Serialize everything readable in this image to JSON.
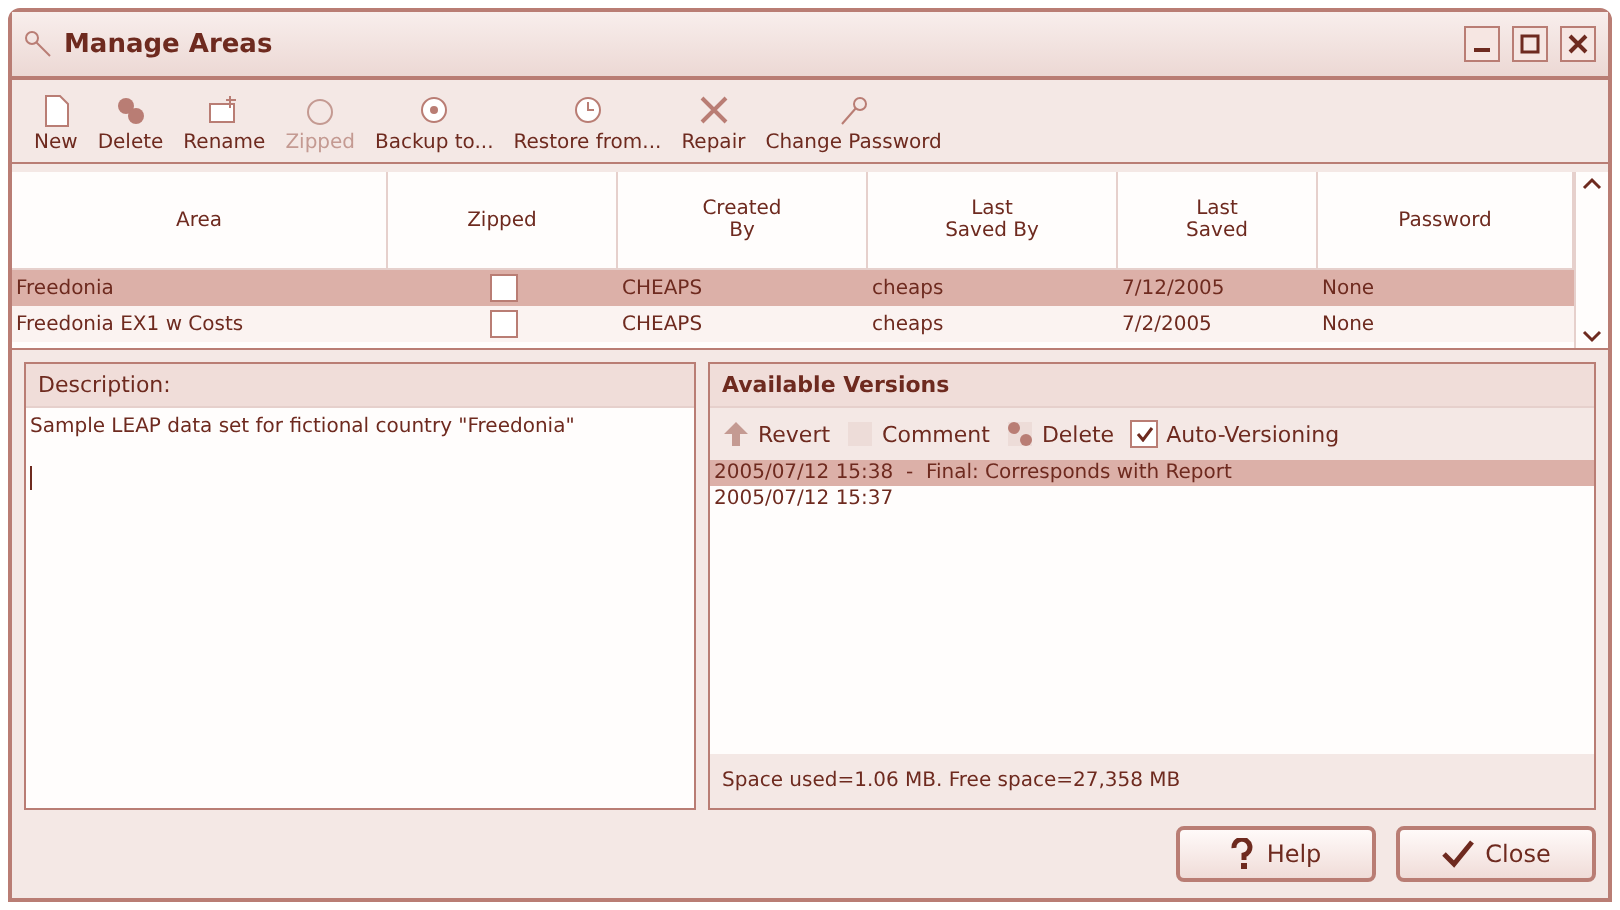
{
  "window": {
    "title": "Manage Areas"
  },
  "toolbar": [
    {
      "label": "New",
      "disabled": false
    },
    {
      "label": "Delete",
      "disabled": false
    },
    {
      "label": "Rename",
      "disabled": false
    },
    {
      "label": "Zipped",
      "disabled": true
    },
    {
      "label": "Backup to...",
      "disabled": false
    },
    {
      "label": "Restore from...",
      "disabled": false
    },
    {
      "label": "Repair",
      "disabled": false
    },
    {
      "label": "Change Password",
      "disabled": false
    }
  ],
  "table": {
    "columns": [
      "Area",
      "Zipped",
      "Created\nBy",
      "Last\nSaved By",
      "Last\nSaved",
      "Password"
    ],
    "rows": [
      {
        "area": "Freedonia",
        "zipped": false,
        "created_by": "CHEAPS",
        "last_saved_by": "cheaps",
        "last_saved": "7/12/2005",
        "password": "None",
        "selected": true
      },
      {
        "area": "Freedonia EX1 w Costs",
        "zipped": false,
        "created_by": "CHEAPS",
        "last_saved_by": "cheaps",
        "last_saved": "7/2/2005",
        "password": "None",
        "selected": false
      }
    ]
  },
  "description": {
    "label": "Description:",
    "value": "Sample LEAP data set for fictional country \"Freedonia\""
  },
  "versions": {
    "title": "Available Versions",
    "actions": [
      {
        "kind": "button",
        "label": "Revert"
      },
      {
        "kind": "button",
        "label": "Comment"
      },
      {
        "kind": "button",
        "label": "Delete"
      },
      {
        "kind": "checkbox",
        "label": "Auto-Versioning",
        "checked": true
      }
    ],
    "items": [
      {
        "text": "2005/07/12 15:38  -  Final: Corresponds with Report",
        "selected": true
      },
      {
        "text": "2005/07/12 15:37",
        "selected": false
      }
    ],
    "status": "Space used=1.06 MB.  Free space=27,358 MB"
  },
  "buttons": [
    {
      "kind": "help",
      "label": "Help"
    },
    {
      "kind": "close",
      "label": "Close"
    }
  ]
}
